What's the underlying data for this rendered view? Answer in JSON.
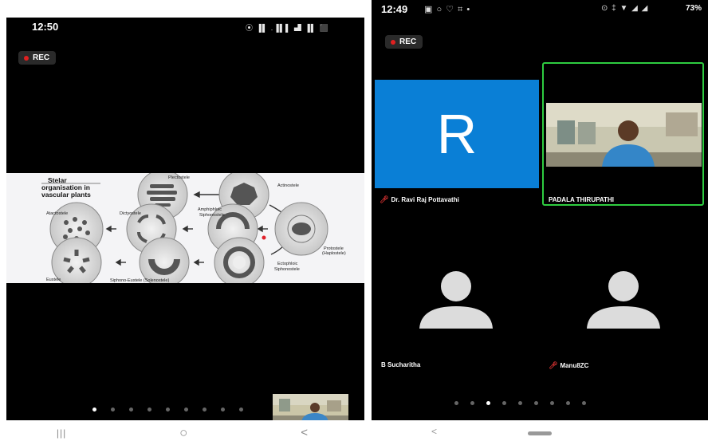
{
  "left": {
    "time": "12:50",
    "status_icons": "⦿ ▐▌ .▐▌▌ ▟ ▐▌ ⬛",
    "rec": "REC",
    "slide": {
      "title_line1": "Stelar",
      "title_line2": "organisation in",
      "title_line3": "vascular plants",
      "labels": {
        "plectostele": "Plectostele",
        "actinostele": "Actinostele",
        "atactostele": "Atactostele",
        "dictyostele": "Dictyostele",
        "amphiphloic": "Amphiphloic",
        "siphonostele": "Siphonostele",
        "protostele": "Protostele",
        "haplostele": "(Haplostele)",
        "ectophloic": "Ectophloic",
        "ecto_siphonostele": "Siphonostele",
        "eustele": "Eustele",
        "siphono_eustele": "Siphono-Eustele (Solenostele)"
      }
    },
    "page_dots": 9,
    "active_dot": 0,
    "nav": {
      "recents": "|||",
      "home": "○",
      "back": "<"
    }
  },
  "right": {
    "time": "12:49",
    "status_left_icons": "▣ ○ ♡ ⌗ •",
    "status_right_icons": "⊙ ‡ ▼ ◢ ◢",
    "battery": "73%",
    "rec": "REC",
    "participants": [
      {
        "name": "Dr. Ravi Raj Pottavathi",
        "initial": "R",
        "muted": true,
        "avatar_color": "#0a7fd6"
      },
      {
        "name": "PADALA THIRUPATHI",
        "muted": false,
        "active_speaker": true
      },
      {
        "name": "B Sucharitha",
        "muted": false
      },
      {
        "name": "Manu8ZC",
        "muted": true
      }
    ],
    "page_dots": 9,
    "active_dot": 2,
    "nav": {
      "back": "<"
    }
  }
}
